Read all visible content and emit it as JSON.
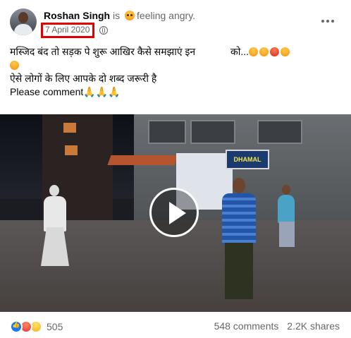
{
  "post": {
    "author": "Roshan Singh",
    "is_text": "is",
    "feeling": "feeling angry.",
    "date": "7 April 2020",
    "text_line1": "मस्जिद बंद तो सड़क पे शुरू आखिर कैसे समझाएं इन",
    "text_line1_tail": "को...",
    "text_line2": " ऐसे लोगों के लिए आपके दो शब्द जरूरी है",
    "text_line3": "Please comment",
    "pray_emojis": "🙏🙏🙏",
    "video_sign": "DHAMAL"
  },
  "footer": {
    "reaction_count": "505",
    "comments": "548 comments",
    "shares": "2.2K shares"
  },
  "icons": [
    "more-options-icon",
    "globe-icon",
    "like-reaction-icon",
    "angry-reaction-icon",
    "haha-reaction-icon",
    "play-icon"
  ],
  "colors": {
    "highlight_box": "#e10000",
    "muted_text": "#65676b",
    "like_blue": "#1877f2"
  }
}
